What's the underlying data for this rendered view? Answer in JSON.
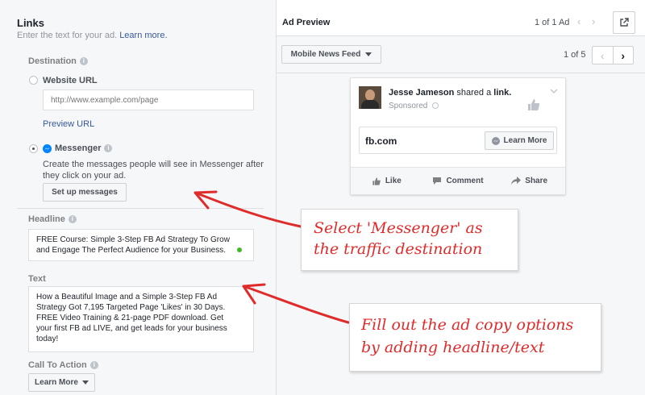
{
  "links": {
    "title": "Links",
    "subtitle": "Enter the text for your ad.",
    "learn_more": "Learn more.",
    "destination_label": "Destination",
    "website_url_label": "Website URL",
    "website_url_placeholder": "http://www.example.com/page",
    "preview_url": "Preview URL",
    "messenger_label": "Messenger",
    "messenger_desc_1": "Create the messages people will see in Messenger after",
    "messenger_desc_2": "they click on your ad.",
    "setup_button": "Set up messages",
    "headline_label": "Headline",
    "headline_line_1": "FREE Course: Simple 3-Step FB Ad Strategy To Grow",
    "headline_line_2": "and Engage The Perfect Audience for your Business.",
    "text_label": "Text",
    "text_lines": [
      "How a Beautiful Image and a Simple 3-Step FB Ad",
      "Strategy Got 7,195 Targeted Page 'Likes' in 30 Days.",
      "FREE Video Training & 21-page PDF download. Get",
      "your first FB ad LIVE, and get leads for your business",
      "today!"
    ],
    "cta_label": "Call To Action",
    "cta_value": "Learn More"
  },
  "preview": {
    "title": "Ad Preview",
    "ad_counter": "1 of 1 Ad",
    "placement": "Mobile News Feed",
    "page_counter": "1 of 5",
    "post": {
      "author": "Jesse Jameson",
      "action": "shared a",
      "object": "link.",
      "sponsored": "Sponsored",
      "domain": "fb.com",
      "cta": "Learn More",
      "like": "Like",
      "comment": "Comment",
      "share": "Share"
    }
  },
  "annotations": {
    "note1_line_1": "Select 'Messenger' as",
    "note1_line_2": "the traffic destination",
    "note2_line_1": "Fill out the ad copy options",
    "note2_line_2": "by adding headline/text"
  },
  "colors": {
    "link": "#365899",
    "annotation": "#e02b2b",
    "status_dot": "#42b72a"
  }
}
